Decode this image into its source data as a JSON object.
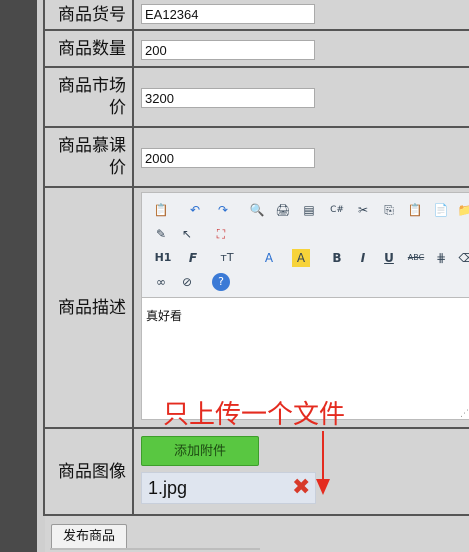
{
  "form": {
    "goods_no": {
      "label": "商品货号",
      "value": "EA12364"
    },
    "quantity": {
      "label": "商品数量",
      "value": "200"
    },
    "market_price": {
      "label_line1": "商品市场",
      "label_line2": "价",
      "value": "3200"
    },
    "course_price": {
      "label_line1": "商品慕课",
      "label_line2": "价",
      "value": "2000"
    },
    "description": {
      "label": "商品描述",
      "content": "真好看"
    },
    "image": {
      "label": "商品图像",
      "attach_button": "添加附件",
      "file_name": "1.jpg",
      "annotation": "只上传一个文件"
    },
    "submit_label": "发布商品"
  },
  "toolbar": {
    "row1": [
      "paste-icon",
      "undo-icon",
      "redo-icon",
      "preview-icon",
      "print-icon",
      "template-icon",
      "code-icon",
      "cut-icon",
      "copy-icon",
      "paste-text-icon",
      "paste-word-icon"
    ],
    "row2": [
      "select-all-icon",
      "pointer-icon",
      "fullscreen-icon"
    ],
    "row3": {
      "heading": "H1",
      "font_family": "F",
      "font_size": "тT",
      "font_color": "A",
      "highlight": "A",
      "bold": "B",
      "italic": "I",
      "underline": "U",
      "strike": "ABC"
    },
    "row4": [
      "link-icon",
      "unlink-icon",
      "help-icon"
    ]
  },
  "colors": {
    "annotation": "#e42b1f",
    "attach_button": "#59c741",
    "delete": "#d73a2a"
  }
}
